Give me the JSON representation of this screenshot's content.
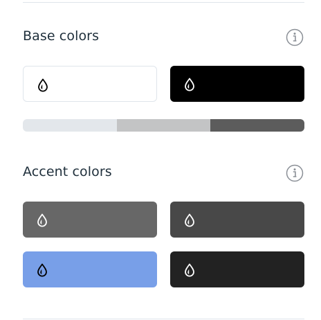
{
  "base": {
    "title": "Base colors",
    "info_icon": "info-icon",
    "swatches": [
      {
        "color": "#ffffff",
        "icon": "color-drop-icon",
        "icon_color": "#000000"
      },
      {
        "color": "#000000",
        "icon": "color-drop-icon",
        "icon_color": "#ffffff"
      }
    ],
    "palette": [
      "#e3e7eb",
      "#c3c4c5",
      "#5c5c5c"
    ]
  },
  "accent": {
    "title": "Accent colors",
    "info_icon": "info-icon",
    "swatches": [
      {
        "color": "#676767",
        "icon": "color-drop-icon",
        "icon_color": "#ffffff"
      },
      {
        "color": "#484848",
        "icon": "color-drop-icon",
        "icon_color": "#ffffff"
      },
      {
        "color": "#789fe8",
        "icon": "color-drop-icon",
        "icon_color": "#000000"
      },
      {
        "color": "#222222",
        "icon": "color-drop-icon",
        "icon_color": "#ffffff"
      }
    ]
  }
}
